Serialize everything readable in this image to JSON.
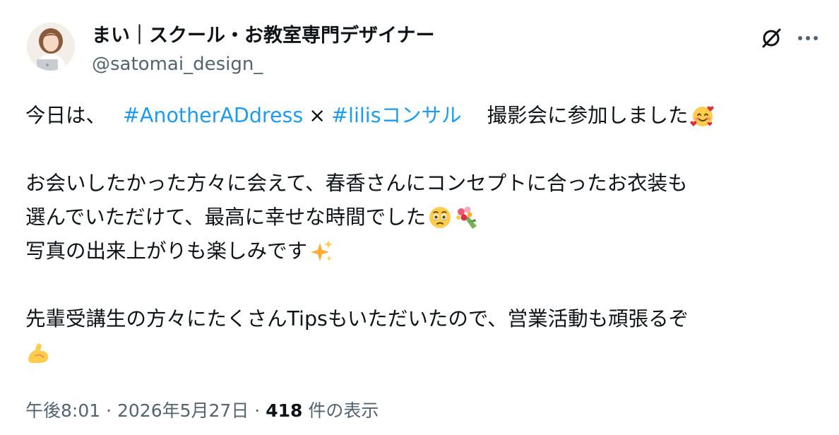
{
  "author": {
    "display_name": "まい｜スクール・お教室専門デザイナー",
    "handle": "@satomai_design_"
  },
  "actions": {
    "grok_icon": "grok-icon",
    "more_icon": "more-dots-icon"
  },
  "post": {
    "line1_prefix": "今日は、",
    "hashtag1": "#AnotherADdress",
    "times_sign": "×",
    "hashtag2": "#lilisコンサル",
    "line1_suffix": "撮影会に参加しました",
    "line2": "お会いしたかった方々に会えて、春香さんにコンセプトに合ったお衣装も",
    "line3": "選んでいただけて、最高に幸せな時間でした",
    "line4": "写真の出来上がりも楽しみです",
    "line5": "先輩受講生の方々にたくさんTipsもいただいたので、営業活動も頑張るぞ",
    "emojis": [
      "smiling-face-with-hearts",
      "face-holding-back-tears",
      "bouquet",
      "sparkles",
      "flexed-biceps"
    ]
  },
  "meta": {
    "time": "午後8:01",
    "separator": "·",
    "date": "2026年5月27日",
    "views_count": "418",
    "views_label": "件の表示"
  },
  "colors": {
    "link": "#1d9bf0",
    "text": "#0f1419",
    "secondary": "#536471"
  }
}
